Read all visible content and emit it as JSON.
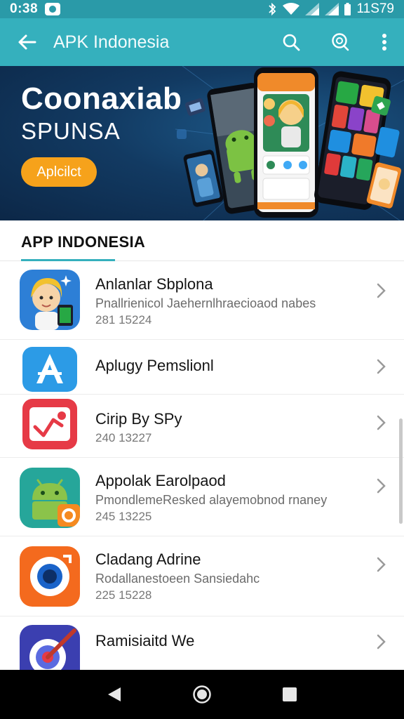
{
  "status_bar": {
    "time": "0:38",
    "right_text": "11S79",
    "icons": [
      "bluetooth-icon",
      "wifi-icon",
      "signal-icon",
      "signal-icon",
      "battery-icon"
    ]
  },
  "app_bar": {
    "title": "APK Indonesia",
    "icons": [
      "back-arrow-icon",
      "search-icon",
      "search-badge-icon",
      "more-vert-icon"
    ]
  },
  "banner": {
    "headline": "Coonaxiab",
    "subheadline": "SPUNSA",
    "cta_label": "Aplcilct",
    "colors": {
      "background": "#123a62",
      "cta": "#f6a21b"
    }
  },
  "section": {
    "title": "APP INDONESIA",
    "accent": "#35b0bd"
  },
  "apps": [
    {
      "name": "Anlanlar Sbplona",
      "description": "Pnallrienicol Jaehernlhraecioaod nabes",
      "meta": "281 15224",
      "icon": "cartoon-girl-icon"
    },
    {
      "name": "Aplugy Pemslionl",
      "description": "",
      "meta": "",
      "icon": "letter-a-icon"
    },
    {
      "name": "Cirip By SPy",
      "description": "",
      "meta": "240 13227",
      "icon": "trend-chart-icon"
    },
    {
      "name": "Appolak Earolpaod",
      "description": "PmondlemeResked alayemobnod rnaney",
      "meta": "245 13225",
      "icon": "android-robot-icon"
    },
    {
      "name": "Cladang Adrine",
      "description": "Rodallanestoeen Sansiedahc",
      "meta": "225 15228",
      "icon": "camera-lens-icon"
    },
    {
      "name": "Ramisiaitd We",
      "description": "",
      "meta": "",
      "icon": "target-pen-icon"
    }
  ],
  "nav_bar": {
    "icons": [
      "nav-back-icon",
      "nav-home-icon",
      "nav-recents-icon"
    ]
  }
}
